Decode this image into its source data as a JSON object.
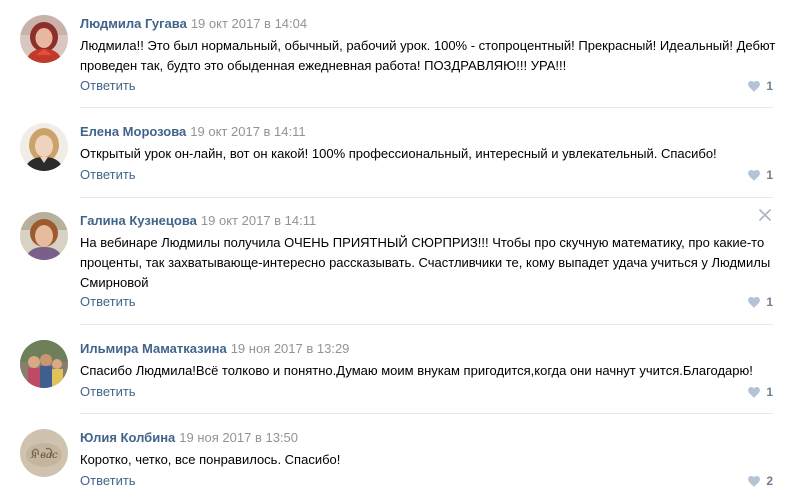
{
  "colors": {
    "author": "#42648b",
    "date": "#939393",
    "reply": "#42648b",
    "like_heart": "#b4c4d6",
    "like_count": "#6f7f93",
    "divider": "#e7e8ec"
  },
  "comments": [
    {
      "author": "Людмила Гугава",
      "date": "19 окт 2017 в 14:04",
      "text": "Людмила!! Это был нормальный, обычный, рабочий урок. 100% - стопроцентный! Прекрасный! Идеальный! Дебют проведен так, будто это обыденная ежедневная работа! ПОЗДРАВЛЯЮ!!! УРА!!!",
      "reply": "Ответить",
      "likes": "1",
      "icon": "heart-icon"
    },
    {
      "author": "Елена Морозова",
      "date": "19 окт 2017 в 14:11",
      "text": "Открытый урок он-лайн, вот он какой! 100% профессиональный, интересный и увлекательный. Спасибо!",
      "reply": "Ответить",
      "likes": "1",
      "icon": "heart-icon"
    },
    {
      "author": "Галина Кузнецова",
      "date": "19 окт 2017 в 14:11",
      "text": "На вебинаре Людмилы получила ОЧЕНЬ ПРИЯТНЫЙ СЮРПРИЗ!!! Чтобы про скучную математику, про какие-то проценты, так захватывающе-интересно рассказывать. Счастливчики те, кому выпадет удача учиться у Людмилы Смирновой",
      "reply": "Ответить",
      "likes": "1",
      "icon": "heart-icon",
      "close_icon": "close-icon"
    },
    {
      "author": "Ильмира Маматказина",
      "date": "19 ноя 2017 в 13:29",
      "text": "Спасибо Людмила!Всё толково и понятно.Думаю моим внукам пригодится,когда они начнут учится.Благодарю!",
      "reply": "Ответить",
      "likes": "1",
      "icon": "heart-icon"
    },
    {
      "author": "Юлия Колбина",
      "date": "19 ноя 2017 в 13:50",
      "text": "Коротко, четко, все понравилось. Спасибо!",
      "reply": "Ответить",
      "likes": "2",
      "icon": "heart-icon",
      "avatar_text": "я вас"
    }
  ]
}
